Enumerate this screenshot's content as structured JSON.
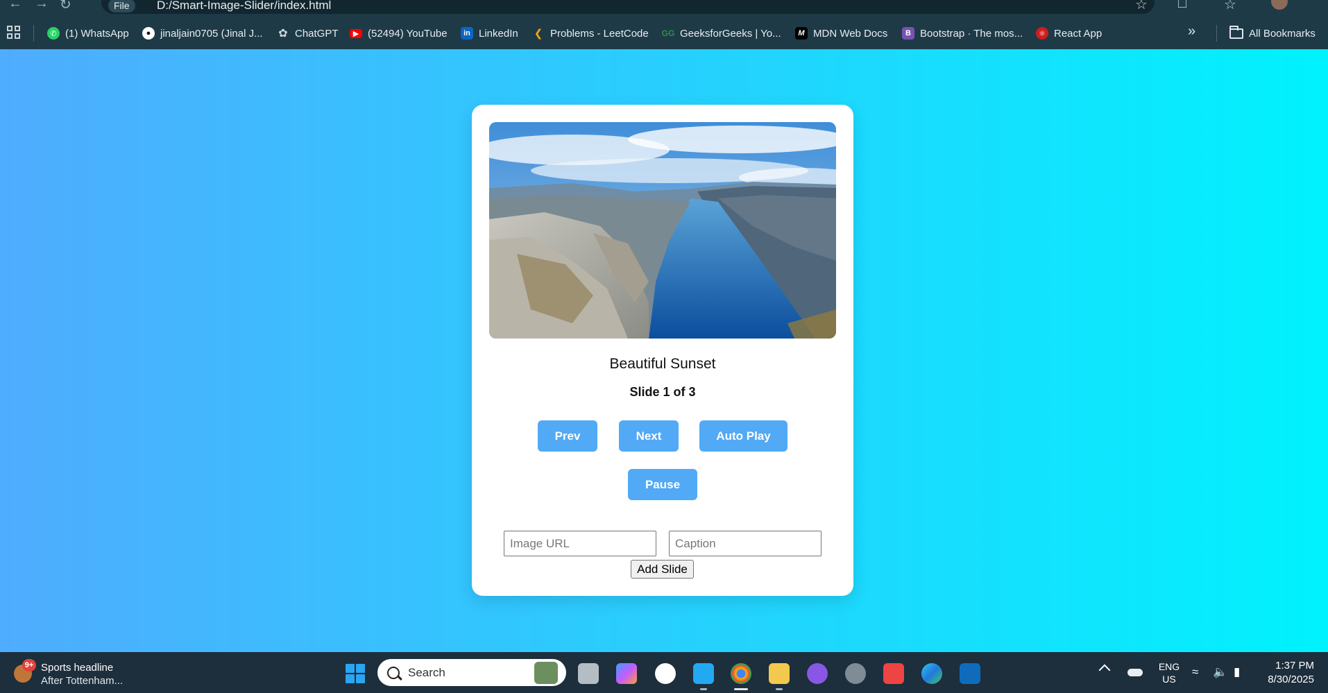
{
  "browser": {
    "site_info_label": "File",
    "url": "D:/Smart-Image-Slider/index.html"
  },
  "bookmarks": {
    "items": [
      {
        "label": "(1) WhatsApp",
        "icon": "whatsapp-icon",
        "color": "#25d366"
      },
      {
        "label": "jinaljain0705 (Jinal J...",
        "icon": "github-icon",
        "color": "#ffffff"
      },
      {
        "label": "ChatGPT",
        "icon": "chatgpt-icon",
        "color": "#cfd8dc"
      },
      {
        "label": "(52494) YouTube",
        "icon": "youtube-icon",
        "color": "#ff0000"
      },
      {
        "label": "LinkedIn",
        "icon": "linkedin-icon",
        "color": "#0a66c2"
      },
      {
        "label": "Problems - LeetCode",
        "icon": "leetcode-icon",
        "color": "#ffa116"
      },
      {
        "label": "GeeksforGeeks | Yo...",
        "icon": "geeksforgeeks-icon",
        "color": "#2f8d46"
      },
      {
        "label": "MDN Web Docs",
        "icon": "mdn-icon",
        "color": "#000000"
      },
      {
        "label": "Bootstrap · The mos...",
        "icon": "bootstrap-icon",
        "color": "#7952b3"
      },
      {
        "label": "React App",
        "icon": "react-icon",
        "color": "#d01c1c"
      }
    ],
    "all_bookmarks_label": "All Bookmarks"
  },
  "slider": {
    "caption": "Beautiful Sunset",
    "counter": "Slide 1 of 3",
    "current_slide": 1,
    "total_slides": 3,
    "buttons": {
      "prev": "Prev",
      "next": "Next",
      "auto_play": "Auto Play",
      "pause": "Pause"
    },
    "accent_color": "#52a9f5",
    "form": {
      "image_url_placeholder": "Image URL",
      "image_url_value": "",
      "caption_placeholder": "Caption",
      "caption_value": "",
      "add_button": "Add Slide"
    }
  },
  "page_gradient": [
    "#4facfe",
    "#00f2fe"
  ],
  "taskbar": {
    "news_badge": "9+",
    "news_title": "Sports headline",
    "news_subtitle": "After Tottenham...",
    "search_label": "Search",
    "language_top": "ENG",
    "language_bottom": "US",
    "time": "1:37 PM",
    "date": "8/30/2025"
  }
}
